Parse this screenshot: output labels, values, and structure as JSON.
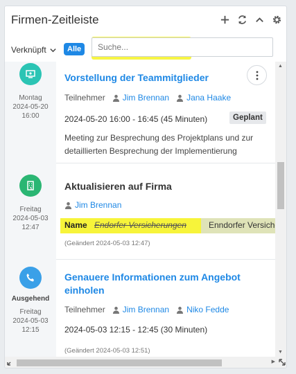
{
  "header": {
    "title": "Firmen-Zeitleiste"
  },
  "filter": {
    "dropdown_label": "Verknüpft",
    "all_button": "Alle",
    "search_placeholder": "Suche..."
  },
  "entries": [
    {
      "icon": "presentation-icon",
      "weekday": "Montag",
      "date": "2024-05-20",
      "time_of_day": "16:00",
      "title": "Vorstellung der Teammitglieder",
      "participants_label": "Teilnehmer",
      "participants": [
        "Jim Brennan",
        "Jana Haake"
      ],
      "time_range": "2024-05-20 16:00 - 16:45 (45 Minuten)",
      "status": "Geplant",
      "description": "Meeting zur Besprechung des Projektplans und zur detaillierten Besprechung der Implementierung"
    },
    {
      "icon": "building-icon",
      "weekday": "Freitag",
      "date": "2024-05-03",
      "time_of_day": "12:47",
      "title": "Aktualisieren auf Firma",
      "user": "Jim Brennan",
      "change_field": "Name",
      "change_old": "Endorfer Versicherungen",
      "change_new": "Enndorfer Versicherungen",
      "changed_note": "(Geändert 2024-05-03 12:47)"
    },
    {
      "icon": "phone-icon",
      "direction": "Ausgehend",
      "weekday": "Freitag",
      "date": "2024-05-03",
      "time_of_day": "12:15",
      "title": "Genauere Informationen zum Angebot einholen",
      "participants_label": "Teilnehmer",
      "participants": [
        "Jim Brennan",
        "Niko Fedde"
      ],
      "time_range": "2024-05-03 12:15 - 12:45 (30 Minuten)",
      "changed_note": "(Geändert 2024-05-03 12:51)"
    }
  ],
  "colors": {
    "accent": "#1e88e5",
    "highlight": "#f7f43a",
    "meeting_icon": "#2bc4b4",
    "update_icon": "#2bb673",
    "call_icon": "#3aa0e8"
  }
}
